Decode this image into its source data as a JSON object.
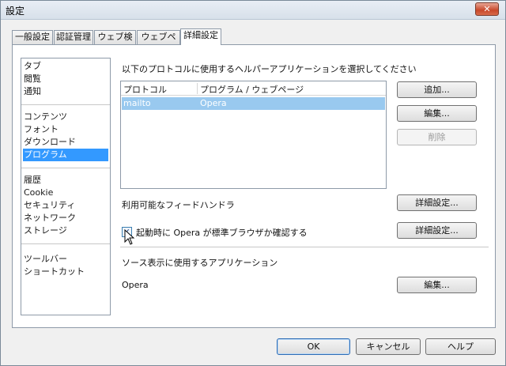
{
  "window": {
    "title": "設定",
    "close_label": "✕"
  },
  "tabs": [
    {
      "label": "一般設定"
    },
    {
      "label": "認証管理"
    },
    {
      "label": "ウェブ検索"
    },
    {
      "label": "ウェブページ"
    },
    {
      "label": "詳細設定"
    }
  ],
  "sidebar": {
    "groups": [
      [
        "タブ",
        "閲覧",
        "通知"
      ],
      [
        "コンテンツ",
        "フォント",
        "ダウンロード",
        "プログラム"
      ],
      [
        "履歴",
        "Cookie",
        "セキュリティ",
        "ネットワーク",
        "ストレージ"
      ],
      [
        "ツールバー",
        "ショートカット"
      ]
    ],
    "selected": "プログラム"
  },
  "programs": {
    "heading": "以下のプロトコルに使用するヘルパーアプリケーションを選択してください",
    "table": {
      "columns": [
        "プロトコル",
        "プログラム / ウェブページ"
      ],
      "rows": [
        [
          "mailto",
          "Opera"
        ]
      ]
    },
    "add_label": "追加...",
    "edit_label": "編集...",
    "delete_label": "削除",
    "feed_label": "利用可能なフィードハンドラ",
    "feed_details_label": "詳細設定...",
    "default_check_label": "起動時に Opera が標準ブラウザか確認する",
    "default_check_checked": true,
    "default_details_label": "詳細設定...",
    "source_heading": "ソース表示に使用するアプリケーション",
    "source_app": "Opera",
    "source_edit_label": "編集..."
  },
  "footer": {
    "ok_label": "OK",
    "cancel_label": "キャンセル",
    "help_label": "ヘルプ"
  }
}
